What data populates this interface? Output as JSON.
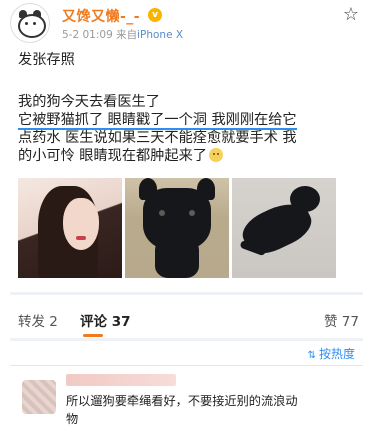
{
  "post": {
    "username": "又馋又懒-_-",
    "vip_badge": "v",
    "time": "5-2 01:09",
    "from_prefix": "来自",
    "device": "iPhone X",
    "line1": "发张存照",
    "line2": "我的狗今天去看医生了",
    "line3": "它被野猫抓了 眼睛戳了一个洞 我刚刚在给它",
    "line4": "点药水 医生说如果三天不能痊愈就要手术 我",
    "line5": "的小可怜 眼睛现在都肿起来了"
  },
  "tabs": [
    {
      "label": "转发 2"
    },
    {
      "label": "评论 37"
    },
    {
      "label": "赞 77"
    }
  ],
  "sort_label": "按热度",
  "comment": {
    "text_line1": "所以遛狗要牵绳看好，不要接近别的流浪动",
    "text_line2": "物"
  },
  "icons": [
    "star-icon",
    "thumb-up-icon",
    "sort-icon"
  ],
  "colors": {
    "username": "#f07a1e",
    "accent_blue": "#2f8ef2",
    "meta": "#9a9a9a"
  }
}
